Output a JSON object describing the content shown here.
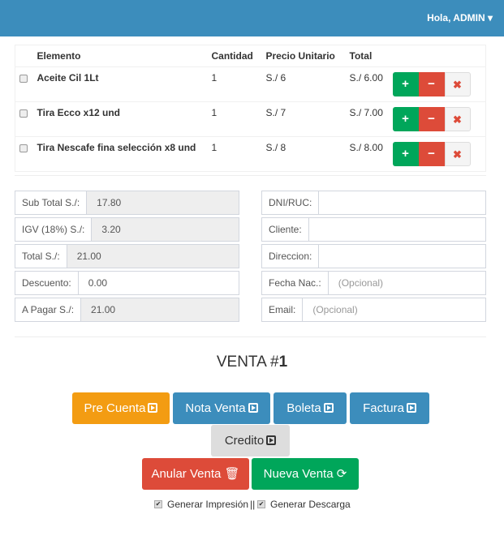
{
  "navbar": {
    "user_label": "Hola, ADMIN"
  },
  "table": {
    "headers": [
      "Elemento",
      "Cantidad",
      "Precio Unitario",
      "Total"
    ],
    "rows": [
      {
        "elemento": "Aceite Cil 1Lt",
        "cantidad": "1",
        "precio": "S./ 6",
        "total": "S./ 6.00"
      },
      {
        "elemento": "Tira Ecco x12 und",
        "cantidad": "1",
        "precio": "S./ 7",
        "total": "S./ 7.00"
      },
      {
        "elemento": "Tira Nescafe fina selección x8 und",
        "cantidad": "1",
        "precio": "S./ 8",
        "total": "S./ 8.00"
      }
    ]
  },
  "totals": {
    "subtotal_label": "Sub Total S./:",
    "subtotal": "17.80",
    "igv_label": "IGV (18%) S./:",
    "igv": "3.20",
    "total_label": "Total S./:",
    "total": "21.00",
    "descuento_label": "Descuento:",
    "descuento": "0.00",
    "apagar_label": "A Pagar S./:",
    "apagar": "21.00"
  },
  "cliente": {
    "dni_label": "DNI/RUC:",
    "dni": "",
    "cliente_label": "Cliente:",
    "cliente": "",
    "direccion_label": "Direccion:",
    "direccion": "",
    "fecha_label": "Fecha Nac.:",
    "fecha_placeholder": "(Opcional)",
    "email_label": "Email:",
    "email_placeholder": "(Opcional)"
  },
  "venta": {
    "title": "VENTA #",
    "number": "1"
  },
  "buttons": {
    "pre_cuenta": "Pre Cuenta",
    "nota_venta": "Nota Venta",
    "boleta": "Boleta",
    "factura": "Factura",
    "credito": "Credito",
    "anular": "Anular Venta",
    "nueva": "Nueva Venta"
  },
  "options": {
    "impresion": "Generar Impresión",
    "separator": "||",
    "descarga": "Generar Descarga"
  },
  "colors": {
    "navbar": "#3c8dbc",
    "success": "#00a65a",
    "danger": "#dd4b39",
    "warning": "#f39c12",
    "primary": "#3c8dbc"
  }
}
